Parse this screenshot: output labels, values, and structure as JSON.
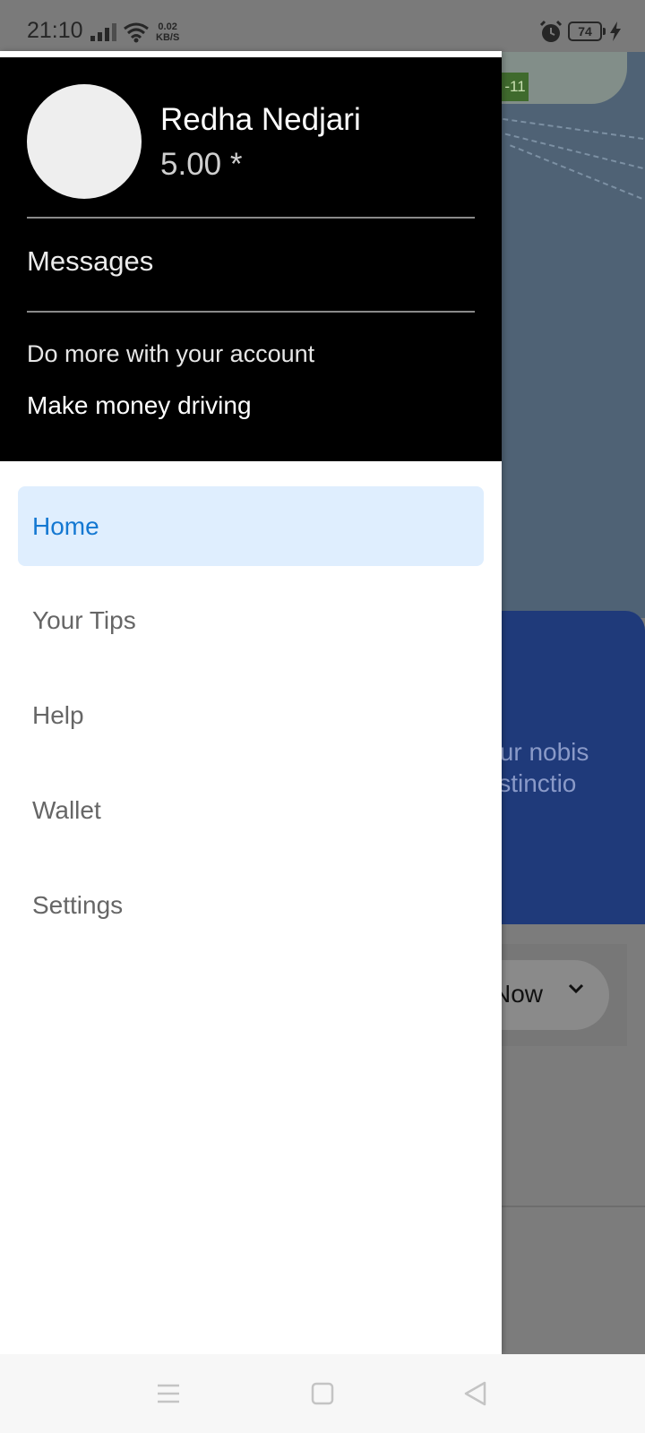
{
  "status_bar": {
    "time": "21:10",
    "net_speed_value": "0.02",
    "net_speed_unit": "KB/S",
    "battery_level": "74"
  },
  "background": {
    "map_badge": "-11",
    "card_line1": "tur nobis",
    "card_line2": "istinctio",
    "schedule_label": "Now"
  },
  "drawer": {
    "profile": {
      "name": "Redha Nedjari",
      "rating": "5.00 *"
    },
    "messages_label": "Messages",
    "more_heading": "Do more with your account",
    "make_money_label": "Make money driving",
    "menu": [
      {
        "label": "Home",
        "active": true
      },
      {
        "label": "Your Tips",
        "active": false
      },
      {
        "label": "Help",
        "active": false
      },
      {
        "label": "Wallet",
        "active": false
      },
      {
        "label": "Settings",
        "active": false
      }
    ]
  },
  "nav_bar": {
    "icons": [
      "menu-icon",
      "home-square-icon",
      "back-triangle-icon"
    ]
  },
  "colors": {
    "drawer_header_bg": "#000000",
    "active_item_bg": "#dfeefe",
    "active_item_text": "#1478d2",
    "menu_text": "#666666",
    "card_blue": "#1f3a7a"
  }
}
